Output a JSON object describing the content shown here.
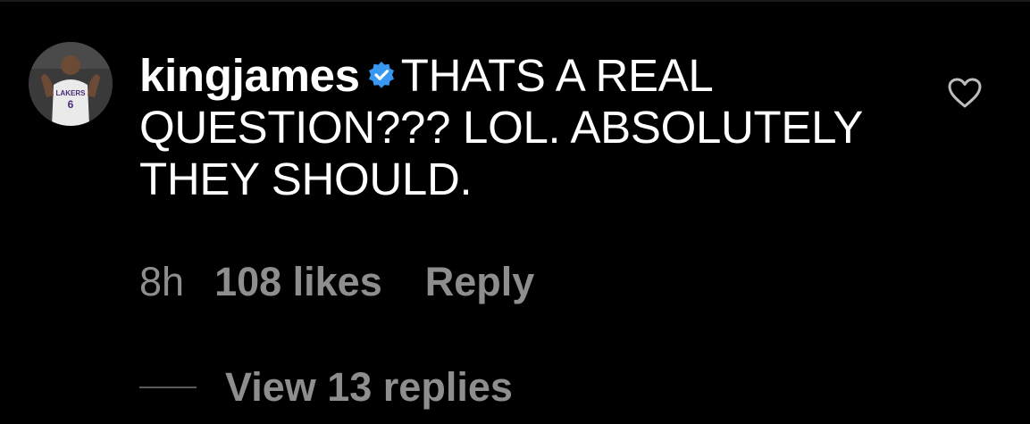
{
  "comment": {
    "username": "kingjames",
    "verified_icon": "verified-badge-icon",
    "text": "THATS A REAL QUESTION??? LOL. ABSOLUTELY THEY SHOULD."
  },
  "meta": {
    "timestamp": "8h",
    "likes": "108 likes",
    "reply_label": "Reply"
  },
  "replies": {
    "view_label": "View 13 replies"
  },
  "icons": {
    "like": "heart-outline-icon",
    "avatar": "profile-avatar"
  },
  "colors": {
    "background": "#000000",
    "primary_text": "#ffffff",
    "secondary_text": "#8e8e8e",
    "verified_blue": "#3897f0"
  }
}
